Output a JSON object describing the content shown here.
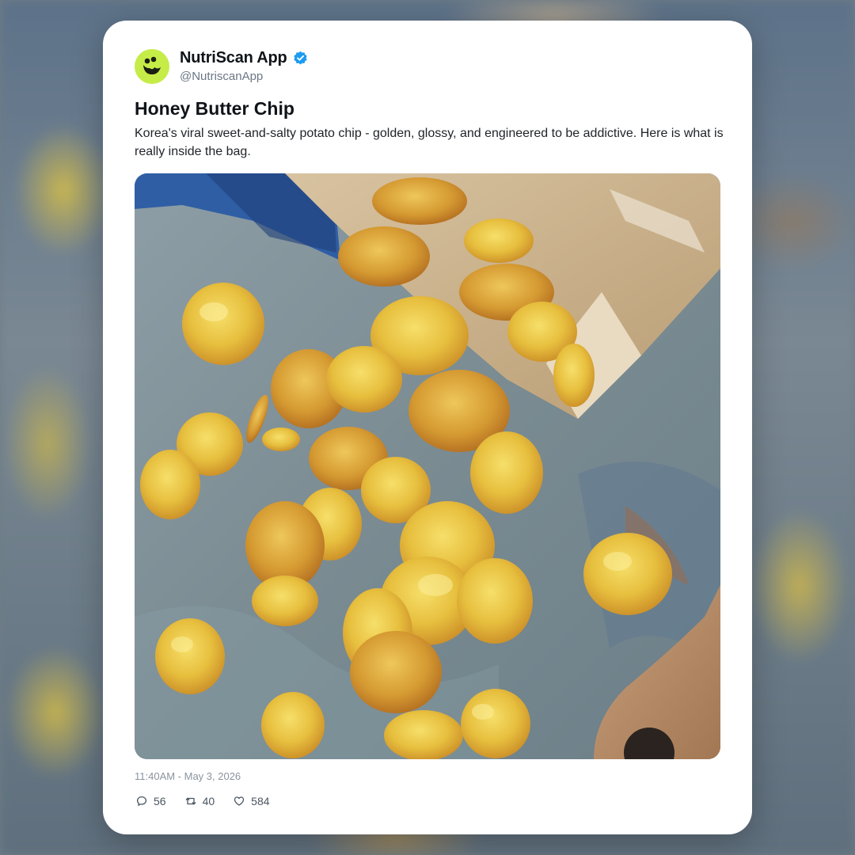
{
  "account": {
    "name": "NutriScan App",
    "handle": "@NutriscanApp",
    "verified": true,
    "avatar_icon": "smiling-bite-logo-icon",
    "avatar_color": "#c6ec48",
    "verified_color": "#1d9bf0"
  },
  "post": {
    "title": "Honey Butter Chip",
    "description": "Korea's viral sweet-and-salty potato chip - golden, glossy, and engineered to be addictive. Here is what is really inside the bag.",
    "image_alt": "Golden potato chips spilling from a paper bag onto a blue-gray stone surface",
    "timestamp": "11:40AM - May 3, 2026"
  },
  "stats": {
    "replies": "56",
    "reposts": "40",
    "likes": "584"
  }
}
